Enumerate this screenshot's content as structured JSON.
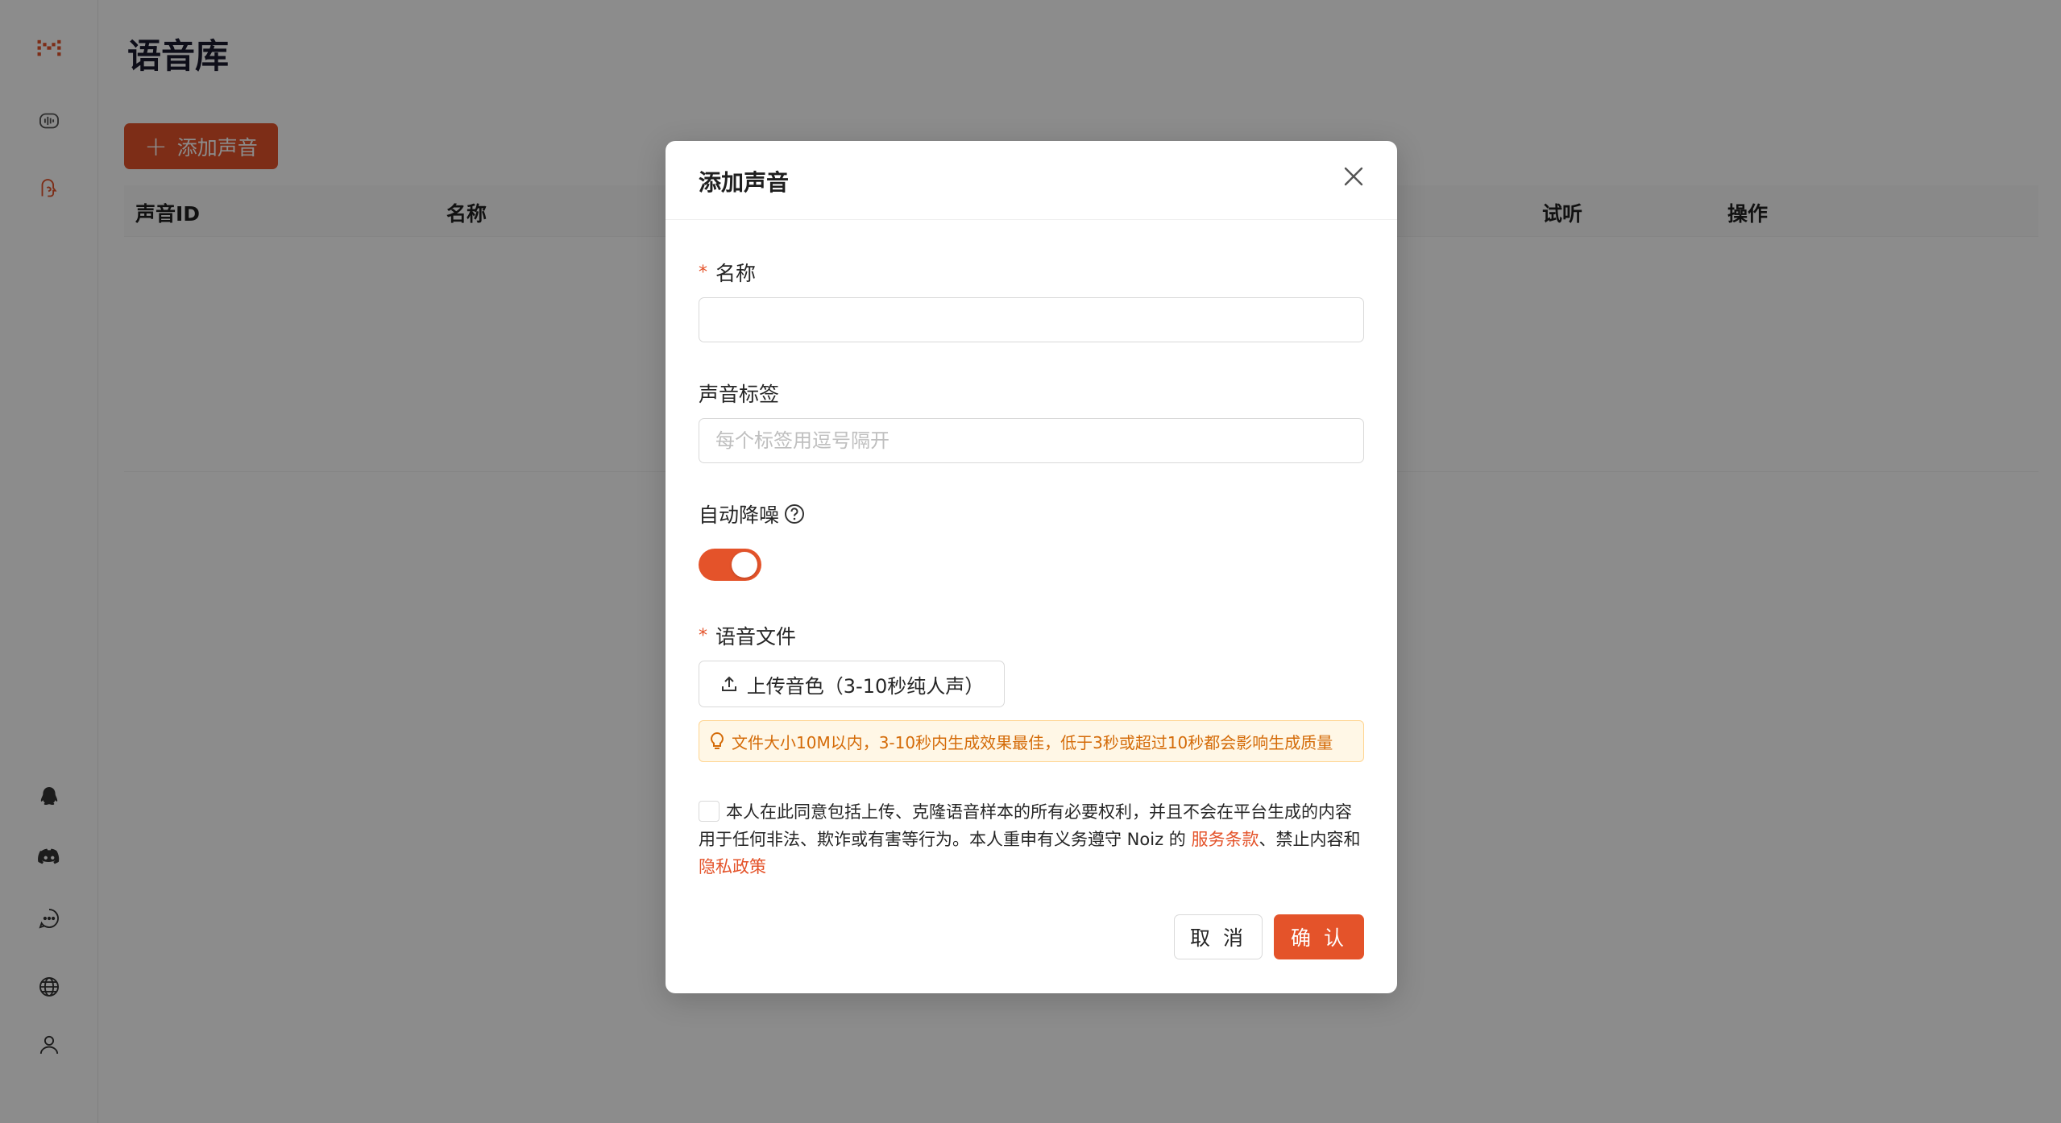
{
  "page": {
    "title": "语音库"
  },
  "toolbar": {
    "add_label": "添加声音"
  },
  "table": {
    "columns": [
      "声音ID",
      "名称",
      "试听",
      "操作"
    ]
  },
  "sidebar": {
    "icons": [
      "logo-icon",
      "voice-icon",
      "voice-clone-icon",
      "qq-icon",
      "discord-icon",
      "chat-icon",
      "globe-icon",
      "user-icon"
    ]
  },
  "modal": {
    "title": "添加声音",
    "name_label": "名称",
    "name_value": "",
    "tags_label": "声音标签",
    "tags_placeholder": "每个标签用逗号隔开",
    "denoise_label": "自动降噪",
    "denoise_enabled": true,
    "file_label": "语音文件",
    "upload_label": "上传音色（3-10秒纯人声）",
    "tip": "文件大小10M以内，3-10秒内生成效果最佳，低于3秒或超过10秒都会影响生成质量",
    "agree_text": "本人在此同意包括上传、克隆语音样本的所有必要权利，并且不会在平台生成的内容用于任何非法、欺诈或有害等行为。本人重申有义务遵守 Noiz 的",
    "terms_link": "服务条款",
    "agree_mid": "、禁止内容和",
    "privacy_link": "隐私政策",
    "cancel_label": "取 消",
    "confirm_label": "确 认"
  },
  "colors": {
    "accent": "#e4532a",
    "mask": "rgba(0,0,0,0.45)"
  }
}
